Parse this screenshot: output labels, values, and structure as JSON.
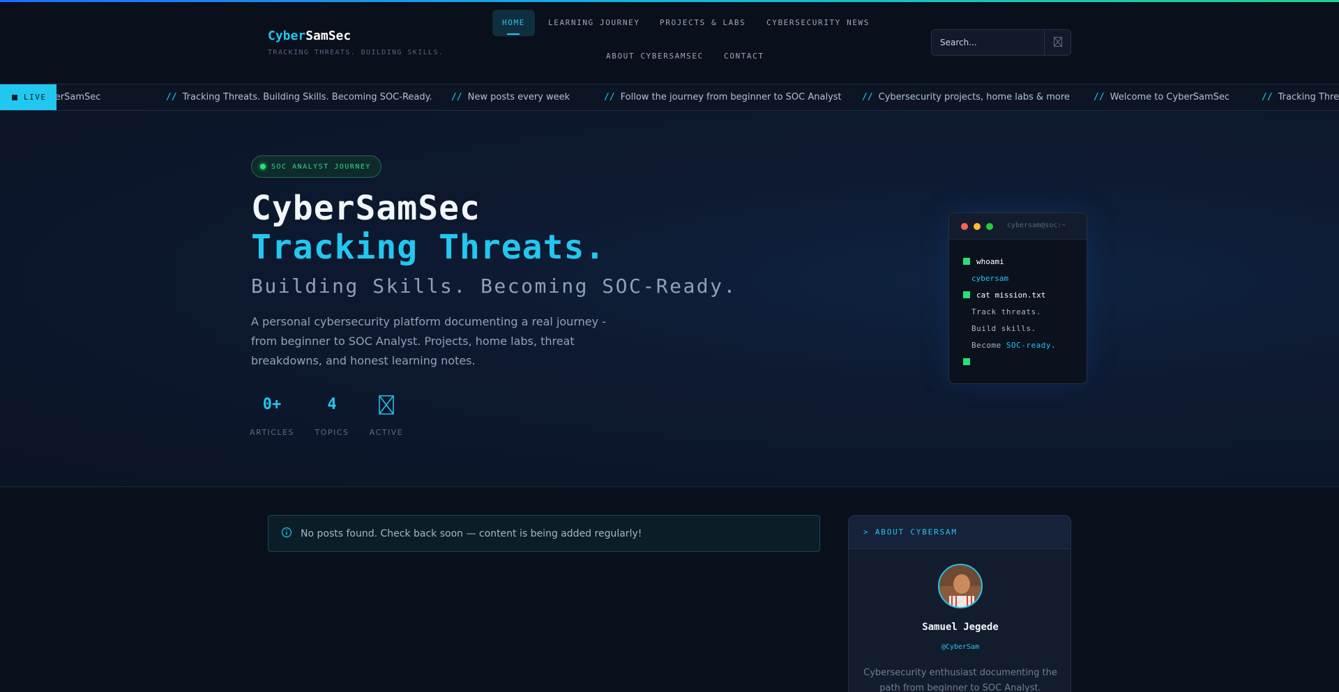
{
  "brand": {
    "logo_part1": "Cyber",
    "logo_part2": "SamSec",
    "tagline": "TRACKING THREATS. BUILDING SKILLS."
  },
  "nav": {
    "home": "HOME",
    "learning": "LEARNING JOURNEY",
    "projects": "PROJECTS & LABS",
    "news": "CYBERSECURITY NEWS",
    "about": "ABOUT CYBERSAMSEC",
    "contact": "CONTACT"
  },
  "search": {
    "placeholder": "Search...",
    "icon": "search-icon"
  },
  "ticker": {
    "live_label": "LIVE",
    "separator": "//",
    "items": [
      "Welcome to CyberSamSec",
      "Tracking Threats. Building Skills. Becoming SOC-Ready.",
      "New posts every week",
      "Follow the journey from beginner to SOC Analyst",
      "Cybersecurity projects, home labs & more",
      "Welcome to CyberSamSec",
      "Tracking Threats. Building Skills. Becoming SOC-Ready."
    ]
  },
  "hero": {
    "badge": "SOC ANALYST JOURNEY",
    "title_line1": "CyberSamSec",
    "title_line2": "Tracking Threats.",
    "title_line3": "Building Skills. Becoming SOC-Ready.",
    "description": "A personal cybersecurity platform documenting a real journey - from beginner to SOC Analyst. Projects, home labs, threat breakdowns, and honest learning notes.",
    "stats": [
      {
        "value": "0+",
        "label": "ARTICLES"
      },
      {
        "value": "4",
        "label": "TOPICS"
      },
      {
        "value": "",
        "label": "ACTIVE",
        "icon": "placeholder-icon"
      }
    ]
  },
  "terminal": {
    "title": "cybersam@soc:~",
    "cmd1": "whoami",
    "out1": "cybersam",
    "cmd2": "cat mission.txt",
    "out2": "Track threats.",
    "out3": "Build skills.",
    "out4_prefix": "Become ",
    "out4_highlight": "SOC-ready",
    "out4_suffix": "."
  },
  "notice": {
    "text": "No posts found. Check back soon — content is being added regularly!",
    "icon": "info-icon"
  },
  "about": {
    "heading": "> ABOUT CYBERSAM",
    "name": "Samuel Jegede",
    "handle": "@CyberSam",
    "bio": "Cybersecurity enthusiast documenting the path from beginner to SOC Analyst. Learning"
  },
  "colors": {
    "accent": "#22c7f0",
    "green": "#27e07a",
    "background": "#0a0f1c"
  }
}
